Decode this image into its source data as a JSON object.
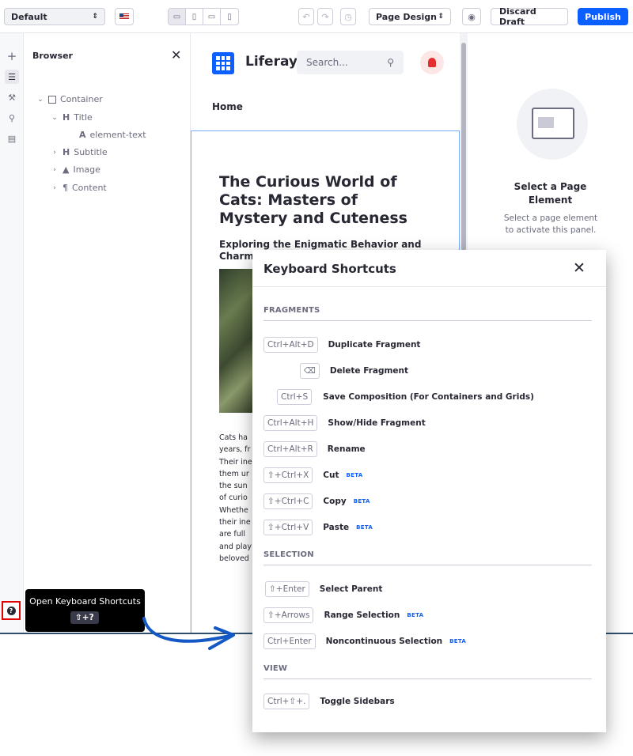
{
  "toolbar": {
    "experience_select": "Default",
    "language_flag": "flag-us-icon",
    "devices": [
      "desktop-icon",
      "tablet-icon",
      "landscape-phone-icon",
      "portrait-phone-icon"
    ],
    "undo_icon": "undo-icon",
    "redo_icon": "redo-icon",
    "history_icon": "history-icon",
    "mode_select": "Page Design",
    "preview_icon": "eye-icon",
    "discard_label": "Discard Draft",
    "publish_label": "Publish",
    "accent_color": "#0b5fff"
  },
  "rail": {
    "icons": [
      "plus-icon",
      "browser-icon",
      "page-design-icon",
      "link-icon",
      "comments-icon"
    ],
    "help_icon": "question-circle-icon"
  },
  "browser": {
    "title": "Browser",
    "tree": [
      {
        "label": "Container",
        "icon": "container-icon",
        "chevron": "⌄"
      },
      {
        "label": "Title",
        "icon": "heading-icon",
        "chevron": "⌄"
      },
      {
        "label": "element-text",
        "icon": "text-icon",
        "chevron": ""
      },
      {
        "label": "Subtitle",
        "icon": "heading-icon",
        "chevron": "›"
      },
      {
        "label": "Image",
        "icon": "image-icon",
        "chevron": "›"
      },
      {
        "label": "Content",
        "icon": "paragraph-icon",
        "chevron": "›"
      }
    ]
  },
  "canvas": {
    "brand": "Liferay",
    "search_placeholder": "Search...",
    "nav_home": "Home",
    "article_title": "The Curious World of Cats: Masters of Mystery and Cuteness",
    "article_subtitle": "Exploring the Enigmatic Behavior and Charm",
    "article_text": [
      "Cats ha",
      "years, fr",
      "Their ine",
      "them ur",
      "the sun",
      "of curio",
      "Whethe",
      "their ine",
      "are full",
      "and play",
      "beloved"
    ]
  },
  "right_panel": {
    "title": "Select a Page Element",
    "description": "Select a page element to activate this panel."
  },
  "tooltip": {
    "label": "Open Keyboard Shortcuts",
    "shortcut": "⇧+?"
  },
  "modal": {
    "title": "Keyboard Shortcuts",
    "sections": {
      "fragments": "FRAGMENTS",
      "selection": "SELECTION",
      "view": "VIEW"
    },
    "beta_label": "BETA",
    "shortcuts": [
      {
        "keys": "Ctrl+Alt+D",
        "label": "Duplicate Fragment",
        "beta": false
      },
      {
        "keys": "⌫",
        "label": "Delete Fragment",
        "beta": false
      },
      {
        "keys": "Ctrl+S",
        "label": "Save Composition (For Containers and Grids)",
        "beta": false
      },
      {
        "keys": "Ctrl+Alt+H",
        "label": "Show/Hide Fragment",
        "beta": false
      },
      {
        "keys": "Ctrl+Alt+R",
        "label": "Rename",
        "beta": false
      },
      {
        "keys": "⇧+Ctrl+X",
        "label": "Cut",
        "beta": true
      },
      {
        "keys": "⇧+Ctrl+C",
        "label": "Copy",
        "beta": true
      },
      {
        "keys": "⇧+Ctrl+V",
        "label": "Paste",
        "beta": true
      },
      {
        "keys": "⇧+Enter",
        "label": "Select Parent",
        "beta": false
      },
      {
        "keys": "⇧+Arrows",
        "label": "Range Selection",
        "beta": true
      },
      {
        "keys": "Ctrl+Enter",
        "label": "Noncontinuous Selection",
        "beta": true
      },
      {
        "keys": "Ctrl+⇧+.",
        "label": "Toggle Sidebars",
        "beta": false
      }
    ]
  }
}
